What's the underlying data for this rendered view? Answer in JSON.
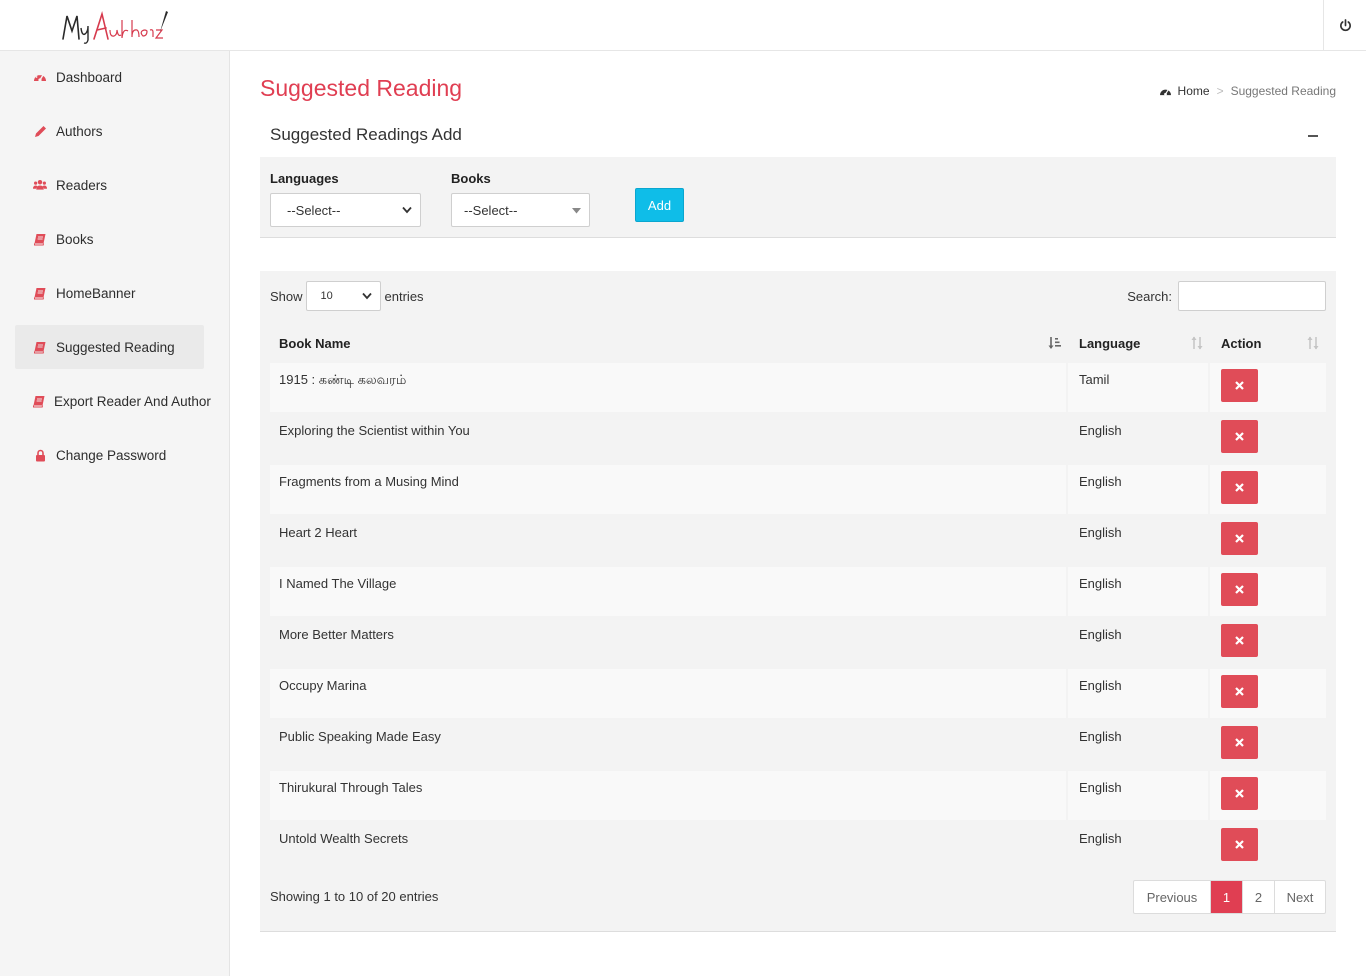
{
  "app": {
    "logo_text": "My Authorz"
  },
  "sidebar": {
    "items": [
      {
        "label": "Dashboard",
        "icon": "dashboard-icon"
      },
      {
        "label": "Authors",
        "icon": "pencil-icon"
      },
      {
        "label": "Readers",
        "icon": "users-icon"
      },
      {
        "label": "Books",
        "icon": "book-icon"
      },
      {
        "label": "HomeBanner",
        "icon": "book-icon"
      },
      {
        "label": "Suggested Reading",
        "icon": "book-icon",
        "active": true
      },
      {
        "label": "Export Reader And Author",
        "icon": "book-icon"
      },
      {
        "label": "Change Password",
        "icon": "lock-icon"
      }
    ]
  },
  "header": {
    "page_title": "Suggested Reading",
    "breadcrumb": {
      "home": "Home",
      "sep": ">",
      "current": "Suggested Reading"
    }
  },
  "form": {
    "title": "Suggested Readings Add",
    "languages_label": "Languages",
    "languages_value": "--Select--",
    "books_label": "Books",
    "books_value": "--Select--",
    "add_label": "Add"
  },
  "table": {
    "show_label": "Show",
    "entries_value": "10",
    "entries_label": "entries",
    "search_label": "Search:",
    "columns": [
      "Book Name",
      "Language",
      "Action"
    ],
    "rows": [
      {
        "book": "1915 : கண்டி கலவரம்",
        "language": "Tamil"
      },
      {
        "book": "Exploring the Scientist within You",
        "language": "English"
      },
      {
        "book": "Fragments from a Musing Mind",
        "language": "English"
      },
      {
        "book": "Heart 2 Heart",
        "language": "English"
      },
      {
        "book": "I Named The Village",
        "language": "English"
      },
      {
        "book": "More Better Matters",
        "language": "English"
      },
      {
        "book": "Occupy Marina",
        "language": "English"
      },
      {
        "book": "Public Speaking Made Easy",
        "language": "English"
      },
      {
        "book": "Thirukural Through Tales",
        "language": "English"
      },
      {
        "book": "Untold Wealth Secrets",
        "language": "English"
      }
    ],
    "info": "Showing 1 to 10 of 20 entries",
    "pagination": {
      "previous": "Previous",
      "pages": [
        "1",
        "2"
      ],
      "current": "1",
      "next": "Next"
    }
  },
  "colors": {
    "accent": "#e03e52",
    "add_button": "#0fbde8",
    "delete_button": "#e04c58",
    "sidebar_bg": "#f5f5f5"
  }
}
